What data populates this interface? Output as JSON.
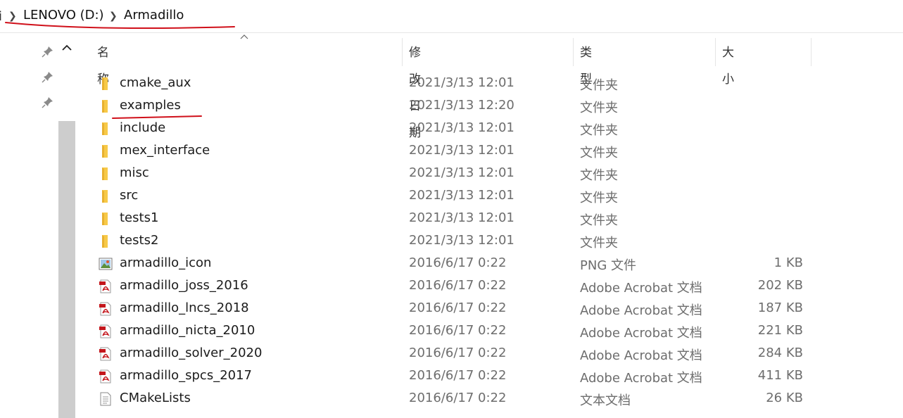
{
  "breadcrumb": {
    "edge_glyph": "i",
    "items": [
      "LENOVO (D:)",
      "Armadillo"
    ]
  },
  "columns": {
    "name": "名称",
    "date": "修改日期",
    "type": "类型",
    "size": "大小"
  },
  "files": [
    {
      "name": "cmake_aux",
      "date": "2021/3/13 12:01",
      "type": "文件夹",
      "size": "",
      "icon": "folder-icon"
    },
    {
      "name": "examples",
      "date": "2021/3/13 12:20",
      "type": "文件夹",
      "size": "",
      "icon": "folder-icon"
    },
    {
      "name": "include",
      "date": "2021/3/13 12:01",
      "type": "文件夹",
      "size": "",
      "icon": "folder-icon"
    },
    {
      "name": "mex_interface",
      "date": "2021/3/13 12:01",
      "type": "文件夹",
      "size": "",
      "icon": "folder-icon"
    },
    {
      "name": "misc",
      "date": "2021/3/13 12:01",
      "type": "文件夹",
      "size": "",
      "icon": "folder-icon"
    },
    {
      "name": "src",
      "date": "2021/3/13 12:01",
      "type": "文件夹",
      "size": "",
      "icon": "folder-icon"
    },
    {
      "name": "tests1",
      "date": "2021/3/13 12:01",
      "type": "文件夹",
      "size": "",
      "icon": "folder-icon"
    },
    {
      "name": "tests2",
      "date": "2021/3/13 12:01",
      "type": "文件夹",
      "size": "",
      "icon": "folder-icon"
    },
    {
      "name": "armadillo_icon",
      "date": "2016/6/17 0:22",
      "type": "PNG 文件",
      "size": "1 KB",
      "icon": "image-file-icon"
    },
    {
      "name": "armadillo_joss_2016",
      "date": "2016/6/17 0:22",
      "type": "Adobe Acrobat 文档",
      "size": "202 KB",
      "icon": "pdf-file-icon"
    },
    {
      "name": "armadillo_lncs_2018",
      "date": "2016/6/17 0:22",
      "type": "Adobe Acrobat 文档",
      "size": "187 KB",
      "icon": "pdf-file-icon"
    },
    {
      "name": "armadillo_nicta_2010",
      "date": "2016/6/17 0:22",
      "type": "Adobe Acrobat 文档",
      "size": "221 KB",
      "icon": "pdf-file-icon"
    },
    {
      "name": "armadillo_solver_2020",
      "date": "2016/6/17 0:22",
      "type": "Adobe Acrobat 文档",
      "size": "284 KB",
      "icon": "pdf-file-icon"
    },
    {
      "name": "armadillo_spcs_2017",
      "date": "2016/6/17 0:22",
      "type": "Adobe Acrobat 文档",
      "size": "411 KB",
      "icon": "pdf-file-icon"
    },
    {
      "name": "CMakeLists",
      "date": "2016/6/17 0:22",
      "type": "文本文档",
      "size": "26 KB",
      "icon": "text-file-icon"
    }
  ],
  "colors": {
    "annotation_red": "#d0101a",
    "folder_yellow": "#f7c948",
    "pdf_red": "#c4161c"
  }
}
